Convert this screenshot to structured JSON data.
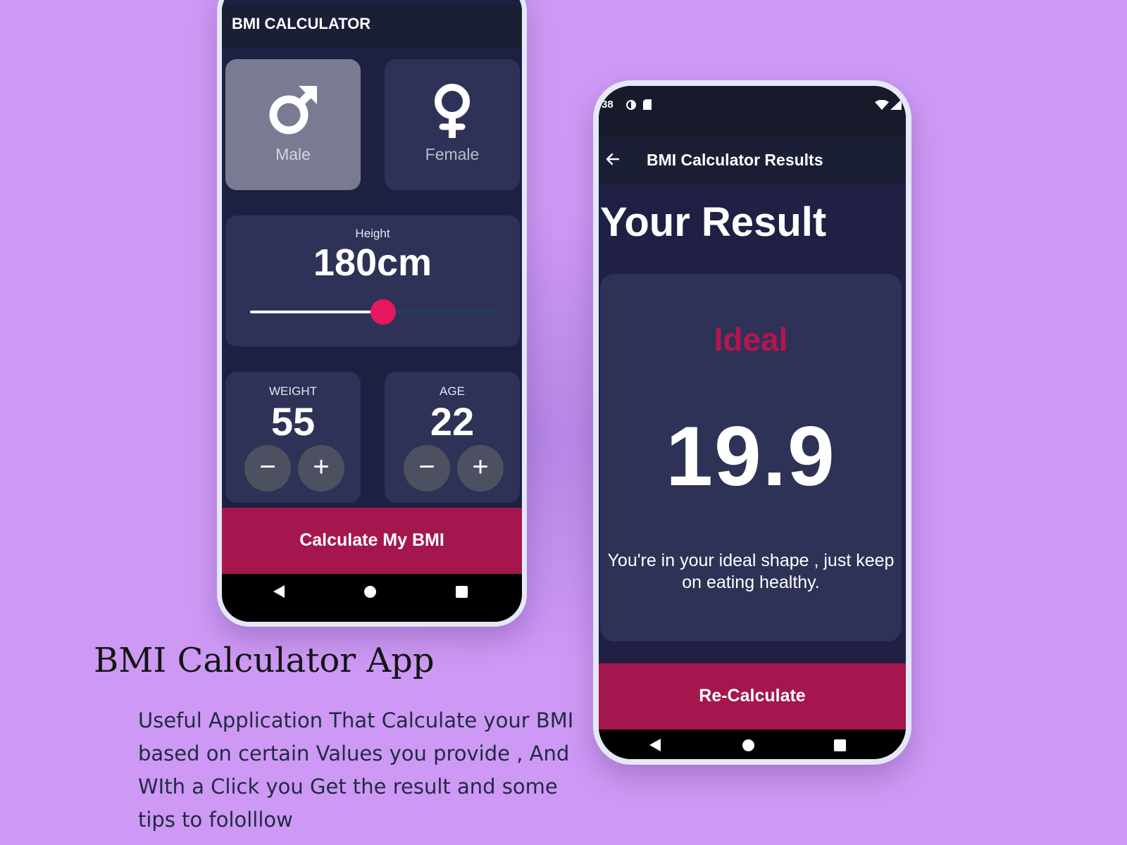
{
  "calculator_screen": {
    "app_title": "BMI CALCULATOR",
    "gender": {
      "options": [
        {
          "label": "Male",
          "icon": "male-symbol-icon",
          "selected": true
        },
        {
          "label": "Female",
          "icon": "female-symbol-icon",
          "selected": false
        }
      ]
    },
    "height": {
      "label": "Height",
      "value": "180cm",
      "slider_fraction": 0.54
    },
    "weight": {
      "label": "WEIGHT",
      "value": "55",
      "decrement": "−",
      "increment": "+"
    },
    "age": {
      "label": "AGE",
      "value": "22",
      "decrement": "−",
      "increment": "+"
    },
    "calculate_button": "Calculate My BMI"
  },
  "results_screen": {
    "status_bar_time": "38",
    "title": "BMI Calculator Results",
    "heading": "Your Result",
    "result_status": "Ideal",
    "bmi_value": "19.9",
    "message": "You're in your ideal shape , just keep on eating healthy.",
    "recalculate_button": "Re-Calculate"
  },
  "caption": {
    "title": "BMI Calculator App",
    "description": "Useful Application That Calculate your BMI based on certain Values you provide , And WIth a Click you Get the result and some tips to fololllow"
  },
  "colors": {
    "background": "#cd99f4",
    "accent_pink": "#e8185e",
    "button_crimson": "#a5164f",
    "card": "#2e3256",
    "status_ideal": "#b3164f"
  }
}
